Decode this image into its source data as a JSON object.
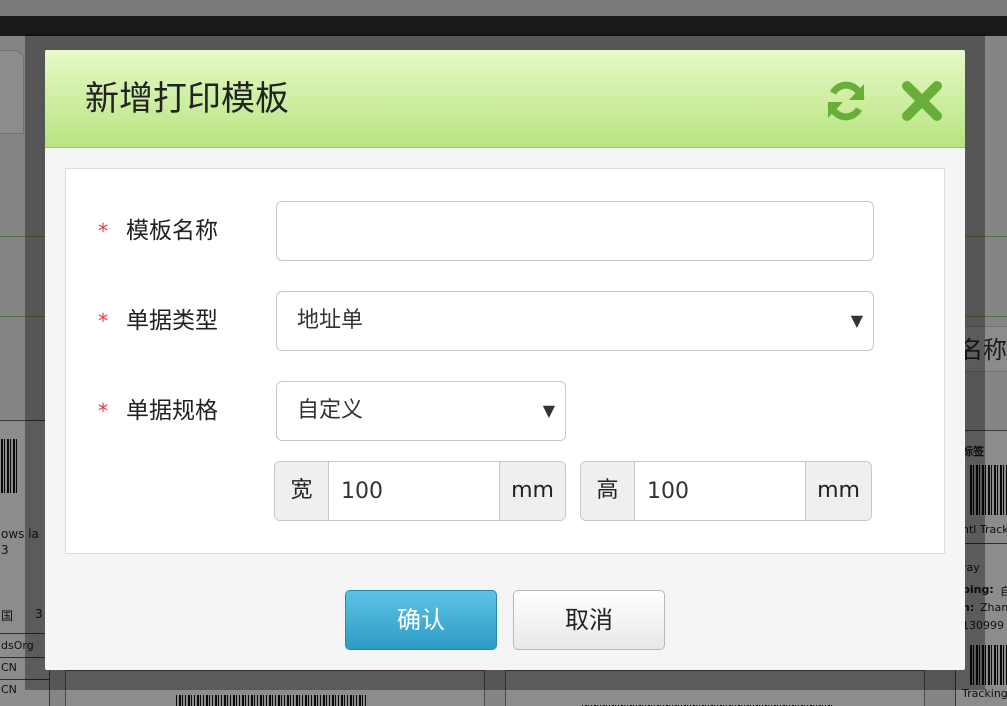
{
  "dialog": {
    "title": "新增打印模板",
    "refresh_icon": "refresh-icon",
    "close_icon": "close-icon"
  },
  "form": {
    "template_name": {
      "label": "模板名称",
      "required_mark": "*",
      "value": "",
      "placeholder": ""
    },
    "doc_type": {
      "label": "单据类型",
      "required_mark": "*",
      "selected": "地址单"
    },
    "doc_spec": {
      "label": "单据规格",
      "required_mark": "*",
      "selected": "自定义"
    },
    "width": {
      "prefix": "宽",
      "value": "100",
      "unit": "mm"
    },
    "height": {
      "prefix": "高",
      "value": "100",
      "unit": "mm"
    }
  },
  "buttons": {
    "confirm": "确认",
    "cancel": "取消"
  },
  "background": {
    "right_label_fragment": "名称",
    "left_card": {
      "line1": "ows la",
      "line2": "3",
      "line3": "国",
      "line4": "3",
      "line5": "dsOrg",
      "line6": "CN",
      "line7": "CN"
    },
    "right_card": {
      "title": "标签",
      "line1": "ntl Track",
      "line2": "ray",
      "line3": "ping:",
      "line3b": "自",
      "line4": "n:",
      "line4b": "Zhan",
      "line5": "130999",
      "line6": "Tracking"
    }
  },
  "colors": {
    "header_top": "#e7f9c9",
    "header_bottom": "#b7e47f",
    "icon_green": "#6aae3a",
    "required_red": "#e23b3b",
    "confirm_blue": "#2e9bc4"
  }
}
